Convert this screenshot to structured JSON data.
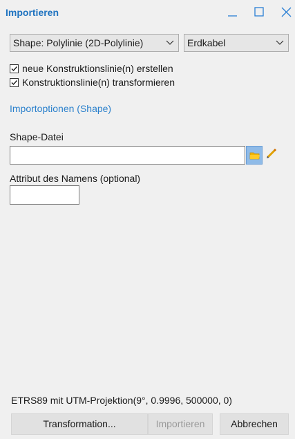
{
  "window": {
    "title": "Importieren"
  },
  "colors": {
    "accent": "#1f73c0",
    "link": "#2a80cc",
    "folder_button": "#8fbbe8",
    "folder_icon": "#f0b400",
    "pencil_icon": "#e0a000"
  },
  "controls": {
    "shape_type_select": "Shape: Polylinie (2D-Polylinie)",
    "layer_select": "Erdkabel"
  },
  "checkboxes": [
    {
      "label": "neue Konstruktionslinie(n) erstellen",
      "checked": true
    },
    {
      "label": "Konstruktionslinie(n) transformieren",
      "checked": true
    }
  ],
  "section": {
    "title": "Importoptionen (Shape)"
  },
  "fields": {
    "shape_file_label": "Shape-Datei",
    "shape_file_value": "",
    "name_attribute_label": "Attribut des Namens (optional)",
    "name_attribute_value": ""
  },
  "icons": {
    "minimize": "minimize-icon",
    "maximize": "maximize-icon",
    "close": "close-icon",
    "browse": "folder-icon",
    "edit": "pencil-icon"
  },
  "footer": {
    "projection": "ETRS89 mit UTM-Projektion(9°, 0.9996, 500000, 0)",
    "transformation_button": "Transformation...",
    "import_button": "Importieren",
    "cancel_button": "Abbrechen"
  }
}
